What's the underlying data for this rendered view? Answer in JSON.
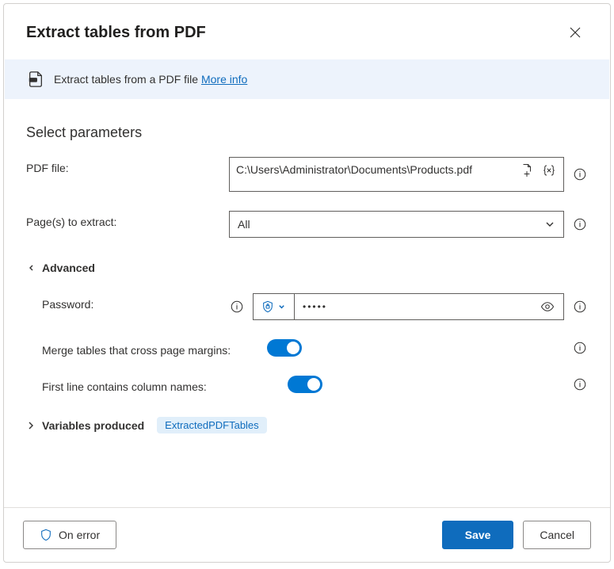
{
  "header": {
    "title": "Extract tables from PDF"
  },
  "banner": {
    "text": "Extract tables from a PDF file",
    "linkText": "More info"
  },
  "section": {
    "title": "Select parameters"
  },
  "params": {
    "pdfFile": {
      "label": "PDF file:",
      "value": "C:\\Users\\Administrator\\Documents\\Products.pdf"
    },
    "pages": {
      "label": "Page(s) to extract:",
      "value": "All"
    }
  },
  "advanced": {
    "header": "Advanced",
    "password": {
      "label": "Password:",
      "value": "•••••"
    },
    "merge": {
      "label": "Merge tables that cross page margins:",
      "on": true
    },
    "firstLine": {
      "label": "First line contains column names:",
      "on": true
    }
  },
  "variables": {
    "header": "Variables produced",
    "pill": "ExtractedPDFTables"
  },
  "footer": {
    "onError": "On error",
    "save": "Save",
    "cancel": "Cancel"
  }
}
